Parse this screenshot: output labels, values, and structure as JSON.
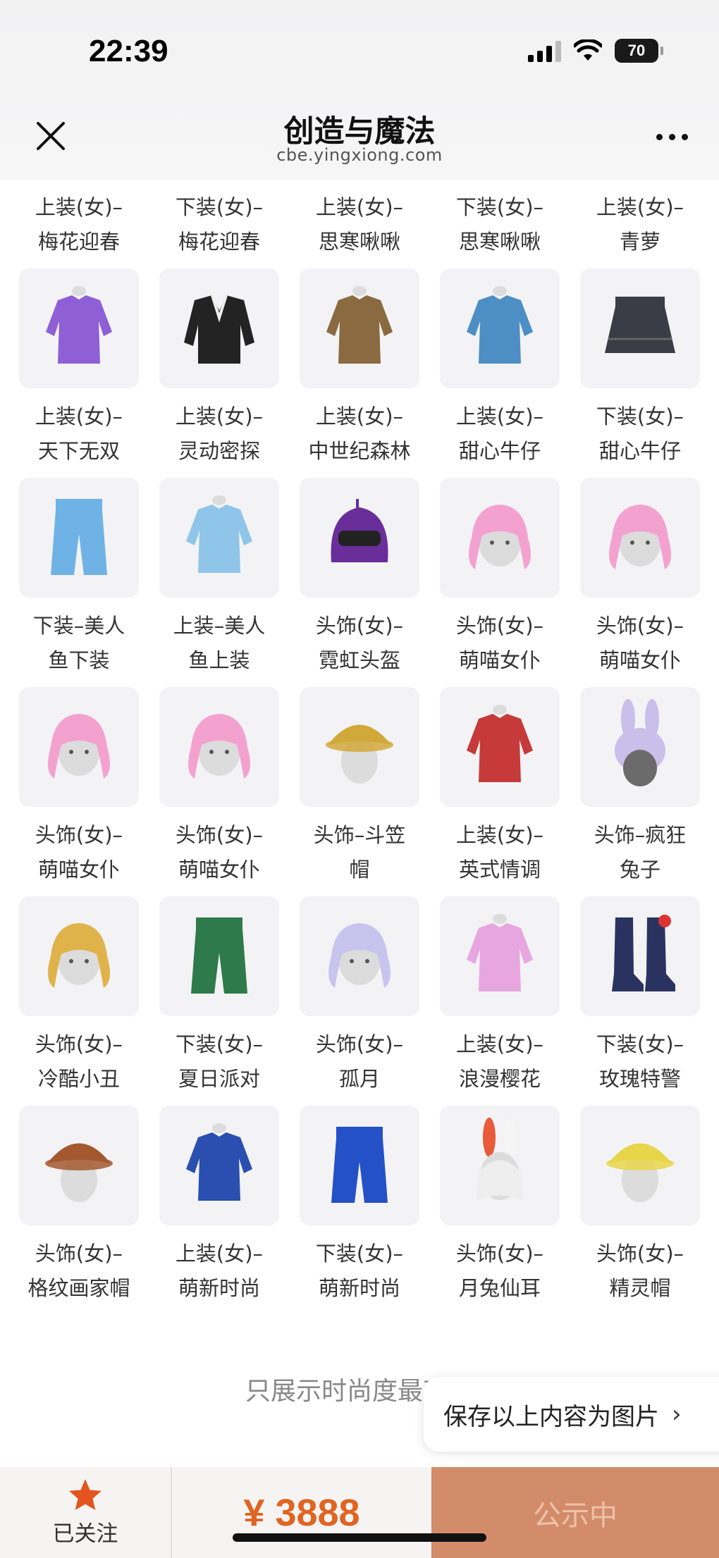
{
  "status_bar": {
    "time": "22:39",
    "battery": "70"
  },
  "header": {
    "title": "创造与魔法",
    "subtitle": "cbe.yingxiong.com"
  },
  "items": [
    {
      "line1": "上装(女)–",
      "line2": "梅花迎春",
      "icon": "top-icon",
      "partial": true
    },
    {
      "line1": "下装(女)–",
      "line2": "梅花迎春",
      "icon": "bottom-icon",
      "partial": true
    },
    {
      "line1": "上装(女)–",
      "line2": "思寒啾啾",
      "icon": "top-icon",
      "partial": true
    },
    {
      "line1": "下装(女)–",
      "line2": "思寒啾啾",
      "icon": "bottom-icon",
      "partial": true
    },
    {
      "line1": "上装(女)–",
      "line2": "青萝",
      "icon": "top-icon",
      "partial": true
    },
    {
      "line1": "上装(女)–",
      "line2": "天下无双",
      "icon": "top-icon",
      "color": "#8f5fd6"
    },
    {
      "line1": "上装(女)–",
      "line2": "灵动密探",
      "icon": "jacket-icon",
      "color": "#232323"
    },
    {
      "line1": "上装(女)–",
      "line2": "中世纪森林",
      "icon": "top-icon",
      "color": "#8a6a40"
    },
    {
      "line1": "上装(女)–",
      "line2": "甜心牛仔",
      "icon": "top-icon",
      "color": "#4d8fc4"
    },
    {
      "line1": "下装(女)–",
      "line2": "甜心牛仔",
      "icon": "skirt-icon",
      "color": "#3a3d45"
    },
    {
      "line1": "下装–美人",
      "line2": "鱼下装",
      "icon": "bottom-icon",
      "color": "#6fb2e6"
    },
    {
      "line1": "上装–美人",
      "line2": "鱼上装",
      "icon": "top-icon",
      "color": "#8fc5e8"
    },
    {
      "line1": "头饰(女)–",
      "line2": "霓虹头盔",
      "icon": "helmet-icon",
      "color": "#6a2e9a"
    },
    {
      "line1": "头饰(女)–",
      "line2": "萌喵女仆",
      "icon": "head-icon",
      "color": "#f3a2d0"
    },
    {
      "line1": "头饰(女)–",
      "line2": "萌喵女仆",
      "icon": "head-icon",
      "color": "#f3a2d0"
    },
    {
      "line1": "头饰(女)–",
      "line2": "萌喵女仆",
      "icon": "head-icon",
      "color": "#f3a2d0"
    },
    {
      "line1": "头饰(女)–",
      "line2": "萌喵女仆",
      "icon": "head-icon",
      "color": "#f3a2d0"
    },
    {
      "line1": "头饰–斗笠",
      "line2": "帽",
      "icon": "hat-icon",
      "color": "#d1a83a"
    },
    {
      "line1": "上装(女)–",
      "line2": "英式情调",
      "icon": "top-icon",
      "color": "#c63a3a"
    },
    {
      "line1": "头饰–疯狂",
      "line2": "兔子",
      "icon": "bunny-hat-icon",
      "color": "#c9bfea"
    },
    {
      "line1": "头饰(女)–",
      "line2": "冷酷小丑",
      "icon": "head-icon",
      "color": "#e0b24a"
    },
    {
      "line1": "下装(女)–",
      "line2": "夏日派对",
      "icon": "bottom-icon",
      "color": "#2f7a4a"
    },
    {
      "line1": "头饰(女)–",
      "line2": "孤月",
      "icon": "head-icon",
      "color": "#c8c4ee"
    },
    {
      "line1": "上装(女)–",
      "line2": "浪漫樱花",
      "icon": "top-icon",
      "color": "#e7a6e0"
    },
    {
      "line1": "下装(女)–",
      "line2": "玫瑰特警",
      "icon": "boots-icon",
      "color": "#2a3360"
    },
    {
      "line1": "头饰(女)–",
      "line2": "格纹画家帽",
      "icon": "hat-icon",
      "color": "#a4582f"
    },
    {
      "line1": "上装(女)–",
      "line2": "萌新时尚",
      "icon": "top-icon",
      "color": "#2a4fb0"
    },
    {
      "line1": "下装(女)–",
      "line2": "萌新时尚",
      "icon": "bottom-icon",
      "color": "#2450c8"
    },
    {
      "line1": "头饰(女)–",
      "line2": "月兔仙耳",
      "icon": "bunny-ears-icon",
      "color": "#e85a3a"
    },
    {
      "line1": "头饰(女)–",
      "line2": "精灵帽",
      "icon": "hat-icon",
      "color": "#e7d64a"
    }
  ],
  "footer": {
    "note": "只展示时尚度最高的",
    "save_label": "保存以上内容为图片",
    "save_chevron": "›"
  },
  "bottom_bar": {
    "follow_label": "已关注",
    "price": "¥ 3888",
    "cta_label": "公示中"
  }
}
